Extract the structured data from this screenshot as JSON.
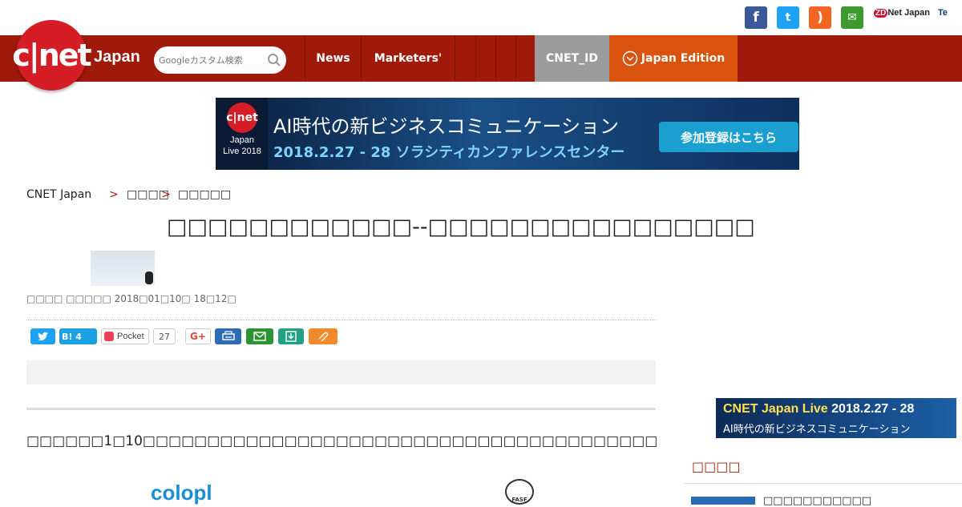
{
  "header": {
    "logo_text": "c|net",
    "logo_sub": "Japan",
    "search_placeholder": "Googleカスタム検索",
    "zdnet_z": "ZD",
    "zdnet_rest": "Net Japan",
    "te_label": "Te",
    "nav": [
      {
        "label": "News"
      },
      {
        "label": "Marketers'"
      },
      {
        "label": "CNET_ID"
      },
      {
        "label": "Japan Edition"
      }
    ],
    "colors": {
      "nav_bg": "#a01a0c",
      "logo": "#d41d24",
      "cnetid_bg": "#9b9b9b",
      "edition_bg": "#d9530f"
    }
  },
  "social_icons": [
    {
      "name": "facebook-icon",
      "glyph": "f",
      "color": "#3b5998"
    },
    {
      "name": "twitter-icon",
      "glyph": "t",
      "color": "#1da1f2"
    },
    {
      "name": "rss-icon",
      "glyph": ")",
      "color": "#f26522"
    },
    {
      "name": "mail-icon",
      "glyph": "✉",
      "color": "#3d9a2f"
    }
  ],
  "banner": {
    "logo": "c|net",
    "sub": "Japan Live 2018",
    "title": "AI時代の新ビジネスコミュニケーション",
    "date": "2018.2.27 - 28 ソラシティカンファレンスセンター",
    "button": "参加登録はこちら"
  },
  "breadcrumb": {
    "home": "CNET Japan",
    "sep": ">",
    "level1": "□□□□",
    "level2": "□□□□□"
  },
  "article": {
    "title": "□□□□□□□□□□□□--□□□□□□□□□□□□□□□□",
    "meta": "□□□□ □□□□□  2018□01□10□ 18□12□",
    "lead": "□□□□□□1□10□□□□□□□□□□□□□□□□□□□□□□□□□□□□□□□□□□□□□□□□",
    "logo_left": "colopl",
    "logo_right": "FASF"
  },
  "share": {
    "hatena": "B! 4",
    "pocket": "Pocket",
    "pocket_count": "27",
    "gplus": "G+"
  },
  "sidebar": {
    "ad_line1a": "CNET Japan Live",
    "ad_line1b": " 2018.2.27 - 28",
    "ad_line2": "AI時代の新ビジネスコミュニケーション",
    "section_title": "□□□□",
    "item_text": "□□□□□□□□□□□"
  }
}
